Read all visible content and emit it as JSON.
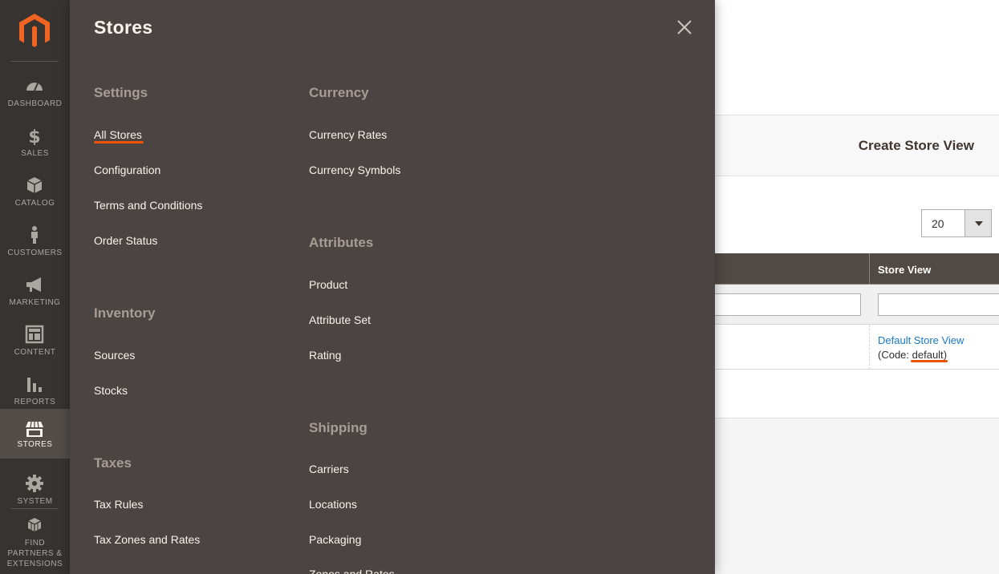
{
  "sidebar": {
    "items": [
      {
        "label": "DASHBOARD",
        "icon": "dashboard-icon"
      },
      {
        "label": "SALES",
        "icon": "dollar-icon"
      },
      {
        "label": "CATALOG",
        "icon": "box-icon"
      },
      {
        "label": "CUSTOMERS",
        "icon": "person-icon"
      },
      {
        "label": "MARKETING",
        "icon": "megaphone-icon"
      },
      {
        "label": "CONTENT",
        "icon": "layout-icon"
      },
      {
        "label": "REPORTS",
        "icon": "bar-chart-icon"
      },
      {
        "label": "STORES",
        "icon": "storefront-icon",
        "active": true
      },
      {
        "label": "SYSTEM",
        "icon": "gear-icon"
      },
      {
        "label": "FIND PARTNERS & EXTENSIONS",
        "icon": "cubes-icon"
      }
    ]
  },
  "page": {
    "create_store_view": "Create Store View",
    "per_page": "20",
    "grid": {
      "column_store_view": "Store View",
      "row": {
        "store_view_link": "Default Store View",
        "code_prefix": "(Code: ",
        "code_value": "default",
        "code_suffix": ")"
      }
    }
  },
  "flyout": {
    "title": "Stores",
    "settings": {
      "title": "Settings",
      "links": [
        "All Stores",
        "Configuration",
        "Terms and Conditions",
        "Order Status"
      ]
    },
    "inventory": {
      "title": "Inventory",
      "links": [
        "Sources",
        "Stocks"
      ]
    },
    "taxes": {
      "title": "Taxes",
      "links": [
        "Tax Rules",
        "Tax Zones and Rates"
      ]
    },
    "currency": {
      "title": "Currency",
      "links": [
        "Currency Rates",
        "Currency Symbols"
      ]
    },
    "attributes": {
      "title": "Attributes",
      "links": [
        "Product",
        "Attribute Set",
        "Rating"
      ]
    },
    "shipping": {
      "title": "Shipping",
      "links": [
        "Carriers",
        "Locations",
        "Packaging",
        "Zones and Rates"
      ]
    }
  },
  "colors": {
    "sidebar_bg": "#373330",
    "flyout_bg": "#4a4542",
    "accent": "#eb5202",
    "link_blue": "#1979c3"
  }
}
